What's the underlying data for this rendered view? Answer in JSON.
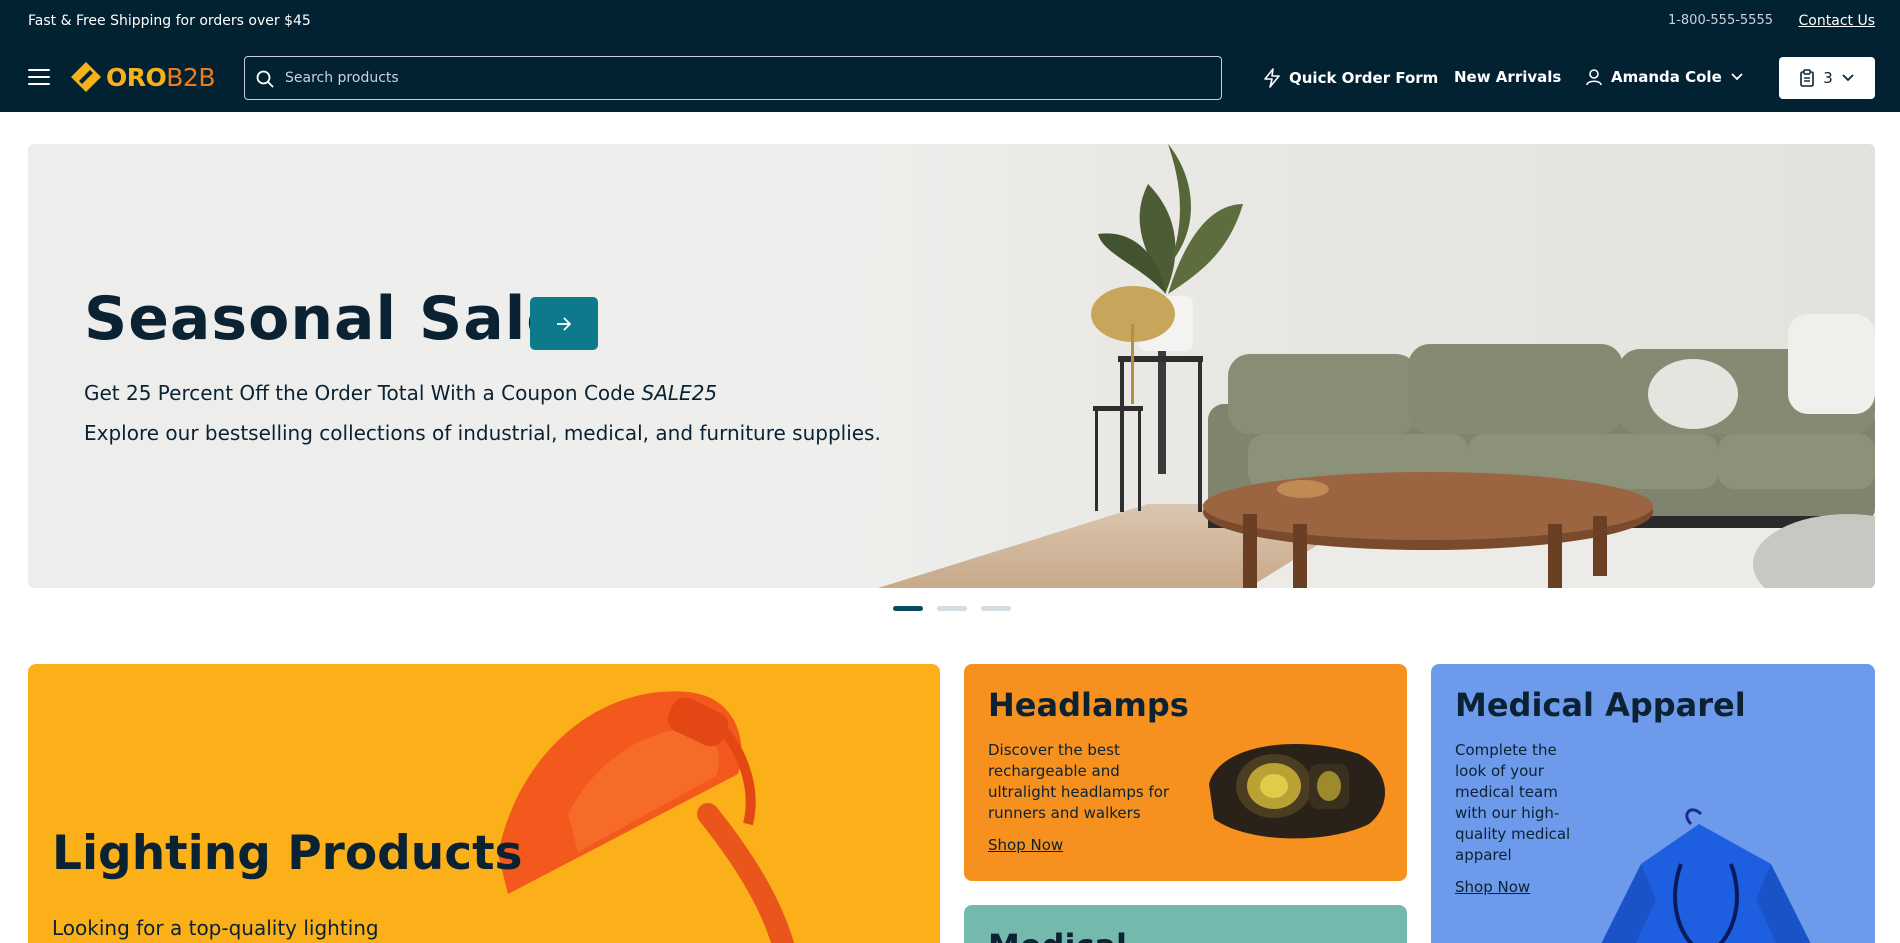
{
  "topbar": {
    "promo": "Fast & Free Shipping for orders over $45",
    "phone": "1-800-555-5555",
    "contact": "Contact Us"
  },
  "header": {
    "logo_oro": "ORO",
    "logo_b2b": "B2B",
    "search_placeholder": "Search products",
    "quick_order": "Quick Order Form",
    "new_arrivals": "New Arrivals",
    "user_name": "Amanda Cole",
    "cart_count": "3"
  },
  "hero": {
    "title": "Seasonal Sale",
    "line1": "Get 25 Percent Off the Order Total With a Coupon Code",
    "coupon": "SALE25",
    "line2": "Explore our bestselling collections of industrial, medical, and furniture supplies.",
    "slides": 3,
    "active_slide": 1
  },
  "tiles": {
    "lighting": {
      "title": "Lighting Products",
      "desc": "Looking for a top-quality lighting"
    },
    "headlamps": {
      "title": "Headlamps",
      "desc": "Discover the best rechargeable and ultralight headlamps for runners and walkers",
      "cta": "Shop Now"
    },
    "medical_apparel": {
      "title": "Medical Apparel",
      "desc": "Complete the look of your medical team with our high-quality medical apparel",
      "cta": "Shop Now"
    },
    "medical": {
      "title": "Medical"
    }
  },
  "colors": {
    "header_bg": "#022232",
    "accent": "#0c7a8a",
    "lighting_tile": "#fbb019",
    "headlamps_tile": "#f6901f",
    "medical_tile": "#6d9aea",
    "medical2_tile": "#75b8ad"
  }
}
